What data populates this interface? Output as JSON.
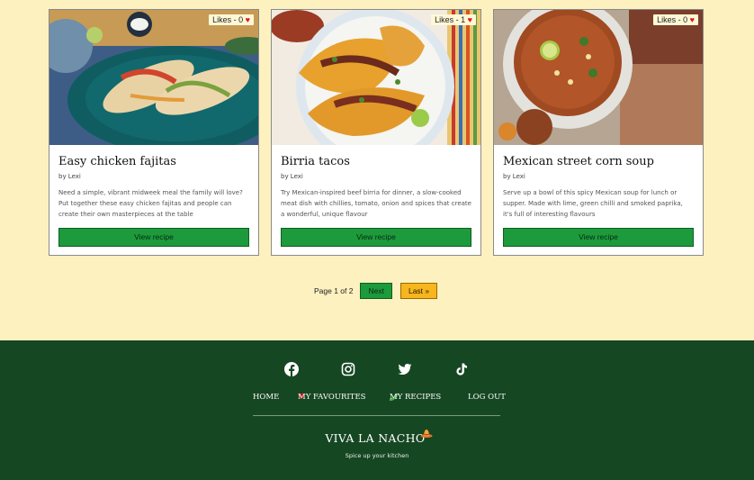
{
  "recipes": [
    {
      "likes": "Likes - 0",
      "title": "Easy chicken fajitas",
      "author": "by Lexi",
      "description": "Need a simple, vibrant midweek meal the family will love? Put together these easy chicken fajitas and people can create their own masterpieces at the table",
      "button": "View recipe"
    },
    {
      "likes": "Likes - 1",
      "title": "Birria tacos",
      "author": "by Lexi",
      "description": "Try Mexican-inspired beef birria for dinner, a slow-cooked meat dish with chillies, tomato, onion and spices that create a wonderful, unique flavour",
      "button": "View recipe"
    },
    {
      "likes": "Likes - 0",
      "title": "Mexican street corn soup",
      "author": "by Lexi",
      "description": "Serve up a bowl of this spicy Mexican soup for lunch or supper. Made with lime, green chilli and smoked paprika, it's full of interesting flavours",
      "button": "View recipe"
    }
  ],
  "pagination": {
    "page_text": "Page 1 of 2",
    "next": "Next",
    "last": "Last »"
  },
  "footer": {
    "social_icons": [
      "facebook-icon",
      "instagram-icon",
      "twitter-icon",
      "tiktok-icon"
    ],
    "nav": {
      "home": "HOME",
      "favourites": "MY FAVOURITES",
      "recipes": "MY RECIPES",
      "logout": "LOG OUT"
    },
    "brand": "VIVA LA NACHO",
    "tagline": "Spice up your kitchen"
  },
  "colors": {
    "background": "#fdf1bf",
    "button_green": "#1d9a3b",
    "last_button": "#f7b61e",
    "footer": "#164723",
    "heart": "#e0141e"
  }
}
